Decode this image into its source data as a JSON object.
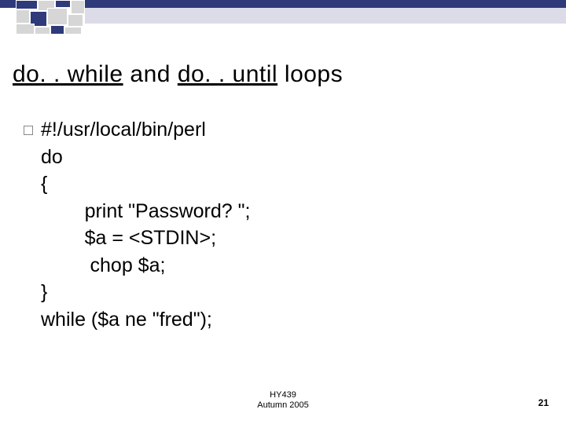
{
  "title": {
    "seg1": "do. . while",
    "mid": " and ",
    "seg2": "do. . until",
    "tail": " loops"
  },
  "code": {
    "l1": "#!/usr/local/bin/perl",
    "l2": "do",
    "l3": "{",
    "l4": "        print \"Password? \";",
    "l5": "        $a = <STDIN>;",
    "l6": "         chop $a;",
    "l7": "}",
    "l8": "while ($a ne \"fred\");"
  },
  "footer": {
    "course": "HY439",
    "term": "Autumn 2005"
  },
  "page_number": "21"
}
